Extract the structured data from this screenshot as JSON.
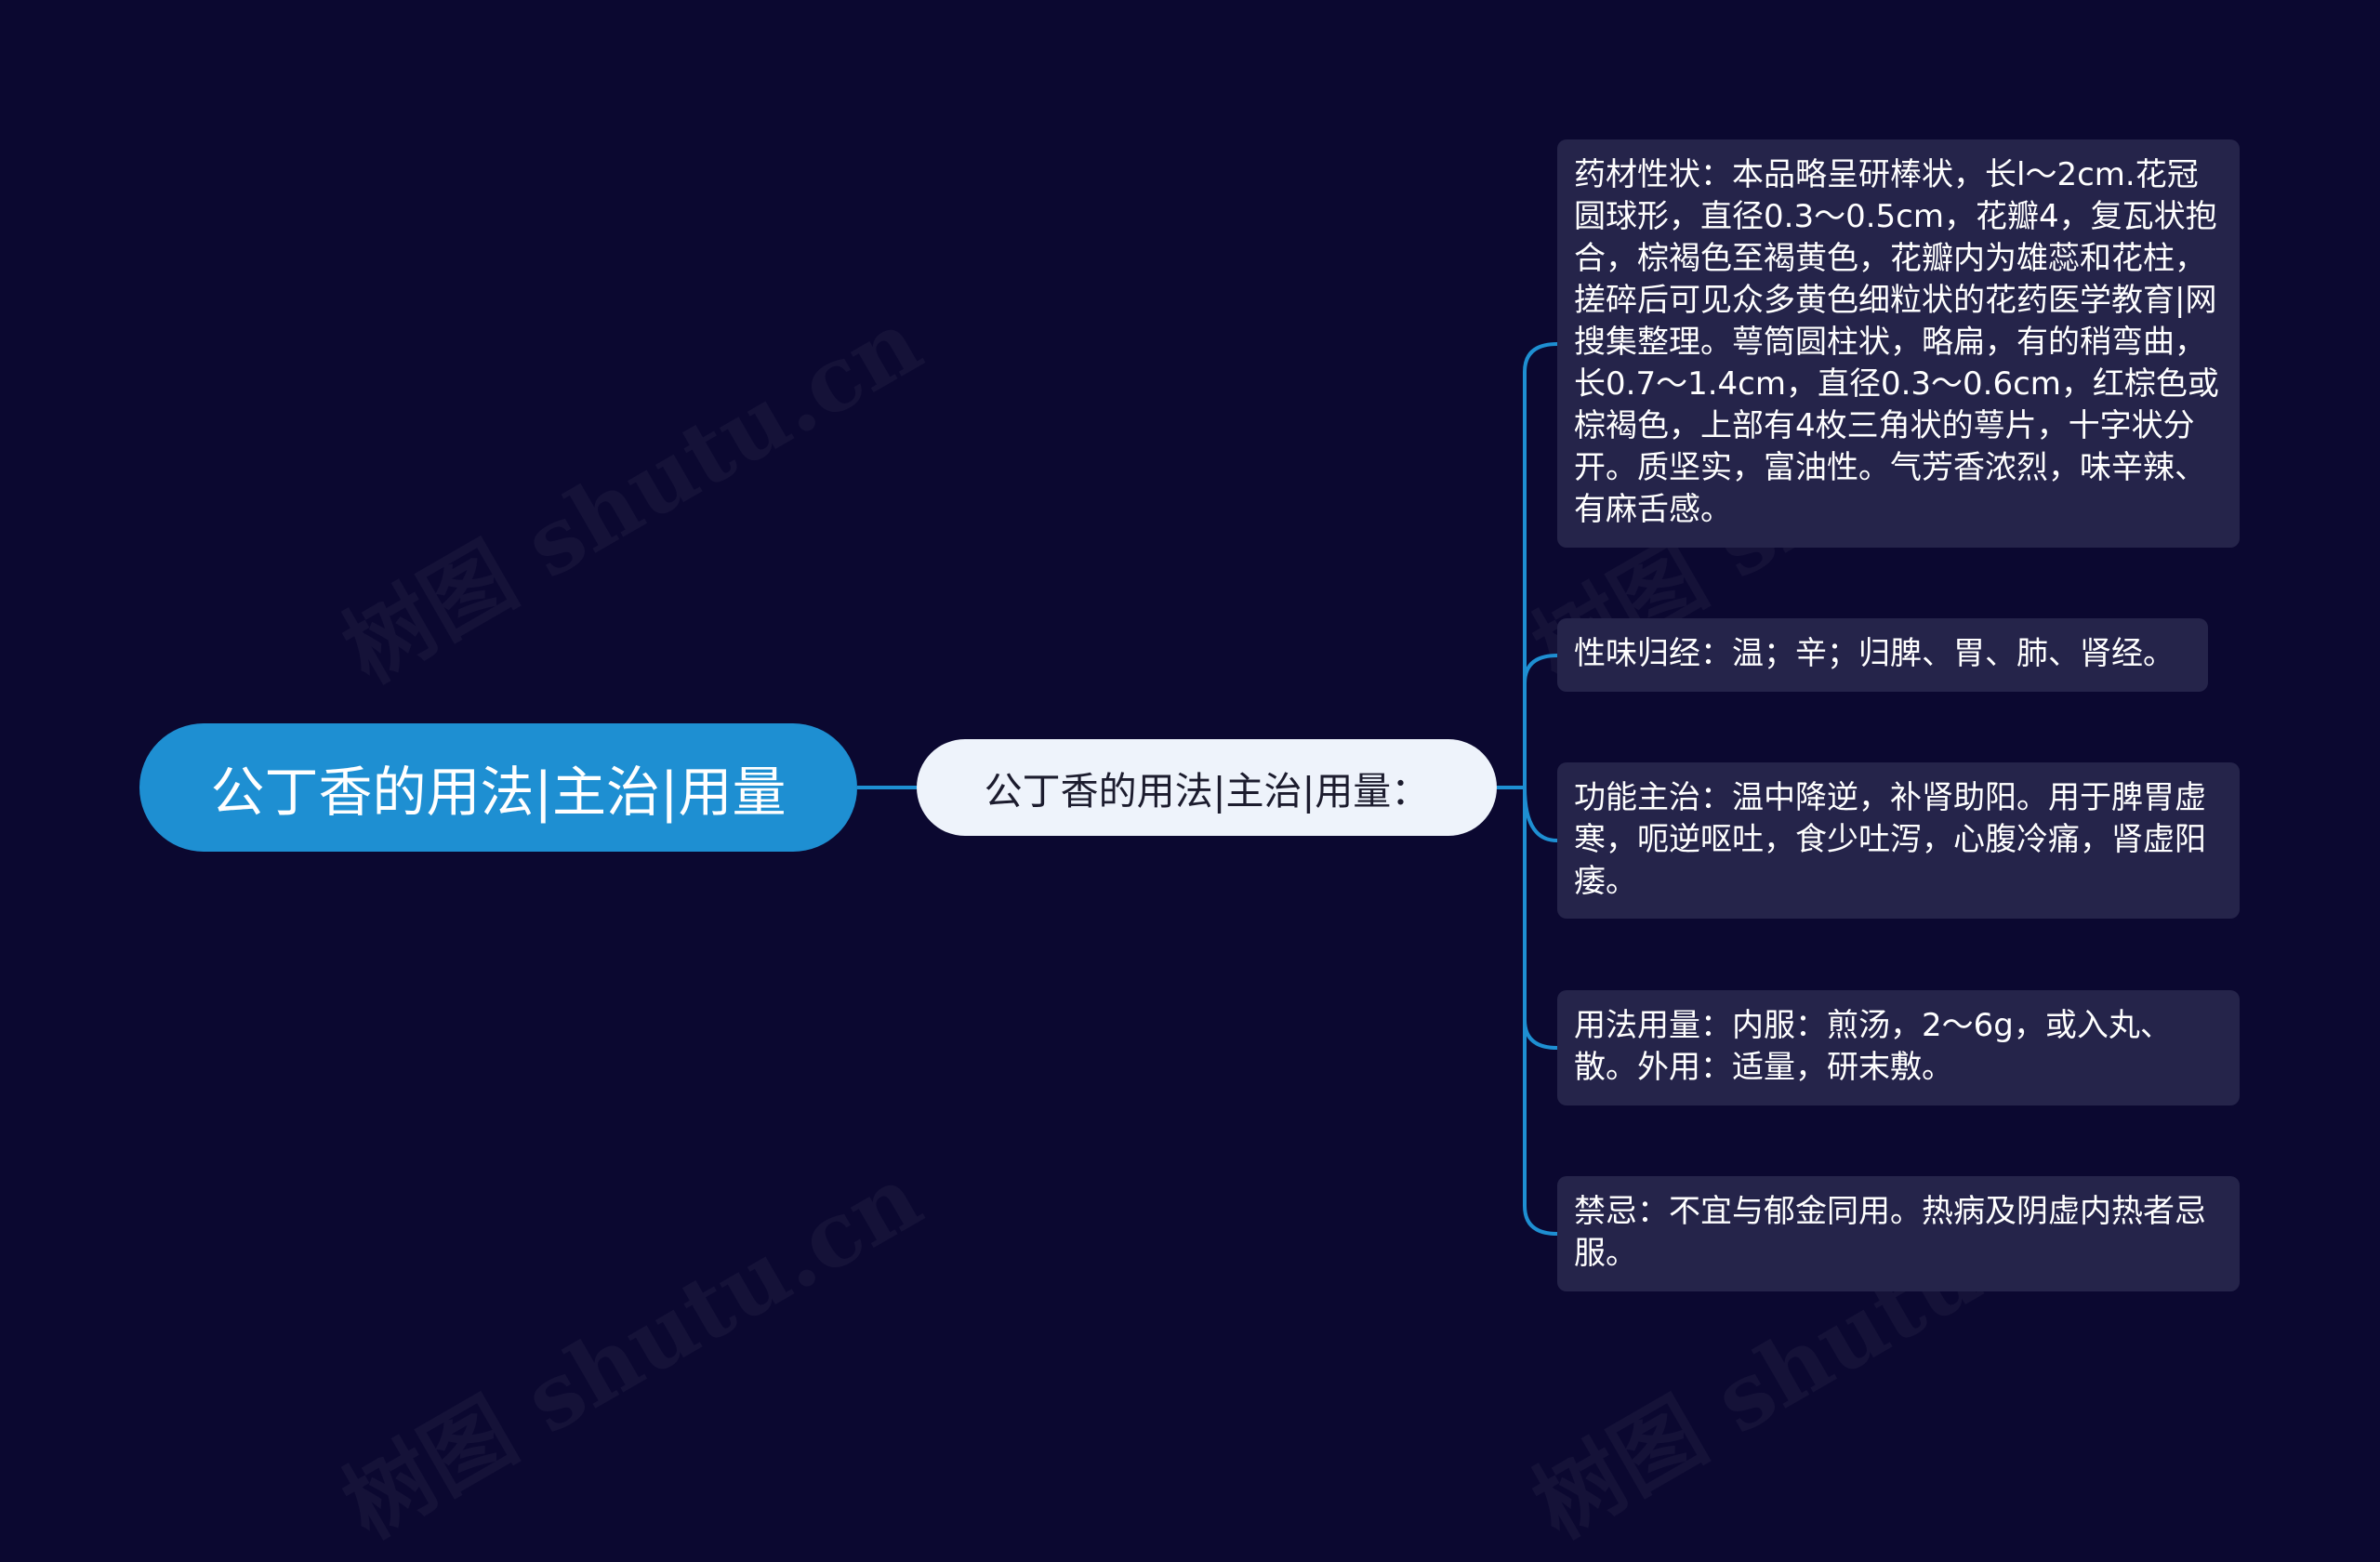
{
  "root": {
    "label": "公丁香的用法|主治|用量"
  },
  "middle": {
    "label": "公丁香的用法|主治|用量："
  },
  "leaves": [
    {
      "text": "药材性状：本品略呈研棒状，长l～2cm.花冠圆球形，直径0.3～0.5cm，花瓣4，复瓦状抱合，棕褐色至褐黄色，花瓣内为雄蕊和花柱，搓碎后可见众多黄色细粒状的花药医学教育|网搜集整理。萼筒圆柱状，略扁，有的稍弯曲，长0.7～1.4cm，直径0.3～0.6cm，红棕色或棕褐色，上部有4枚三角状的萼片，十字状分开。质坚实，富油性。气芳香浓烈，味辛辣、有麻舌感。"
    },
    {
      "text": "性味归经：温；辛；归脾、胃、肺、肾经。"
    },
    {
      "text": "功能主治：温中降逆，补肾助阳。用于脾胃虚寒，呃逆呕吐，食少吐泻，心腹冷痛，肾虚阳痿。"
    },
    {
      "text": "用法用量：内服：煎汤，2～6g，或入丸、散。外用：适量，研末敷。"
    },
    {
      "text": "禁忌：不宜与郁金同用。热病及阴虚内热者忌服。"
    }
  ],
  "watermark": {
    "text": "树图 shutu.cn"
  },
  "colors": {
    "background": "#0b0830",
    "root": "#1e8fd2",
    "middle": "#eef3fb",
    "leaf": "#25244a",
    "connector": "#1e8fd2"
  }
}
